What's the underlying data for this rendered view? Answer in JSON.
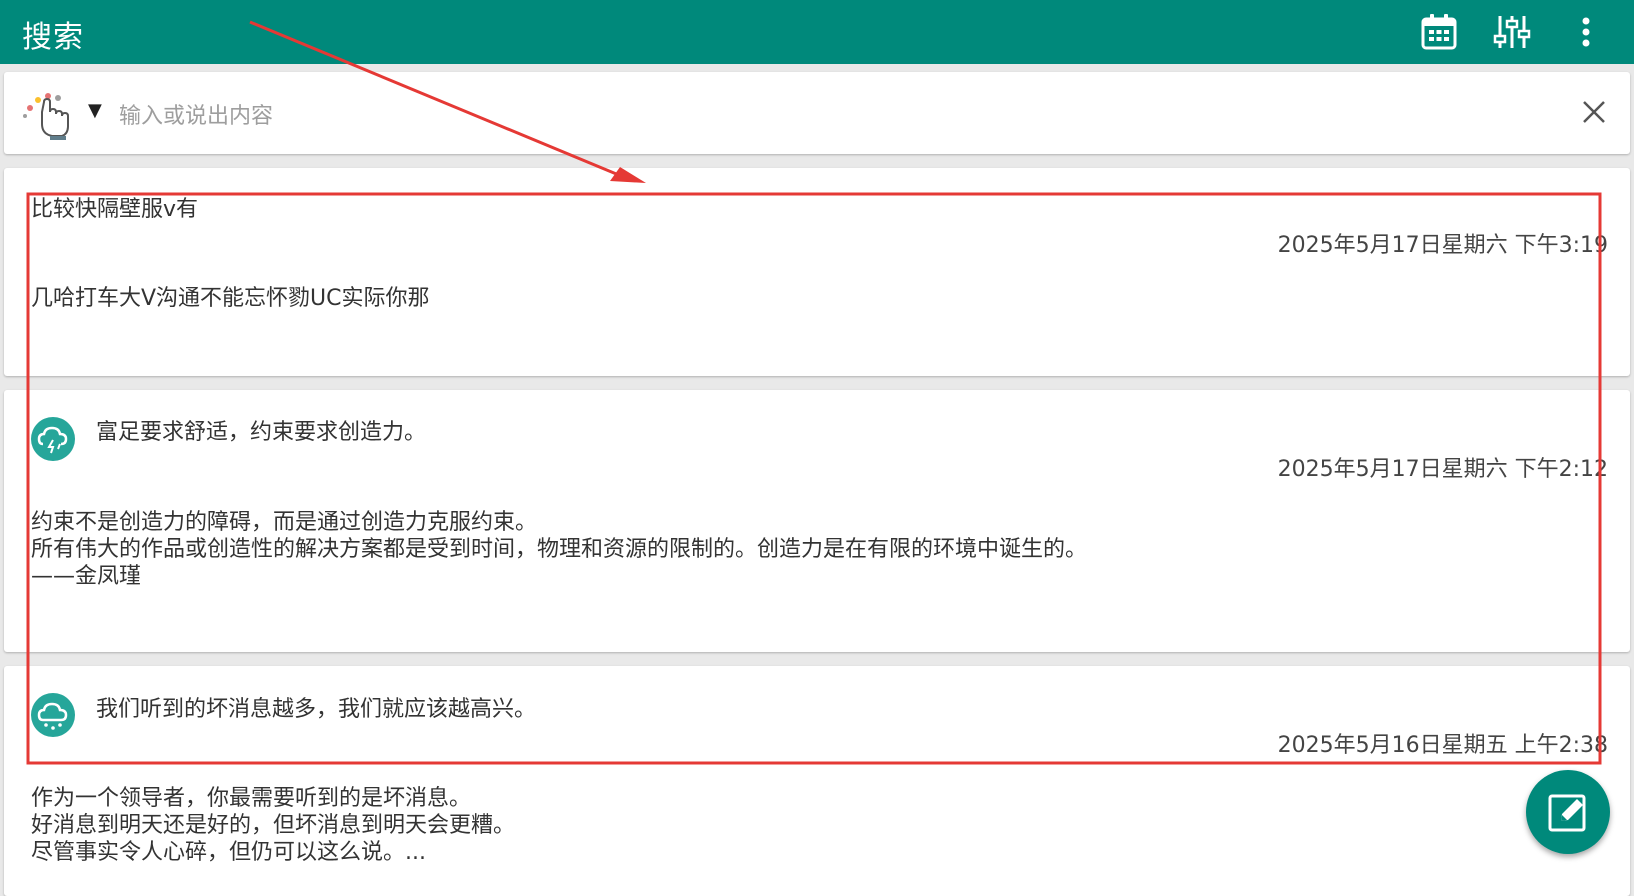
{
  "appbar": {
    "title": "搜索",
    "actions": [
      "calendar-icon",
      "tune-icon",
      "more-vert-icon"
    ],
    "color": "#00897b"
  },
  "search": {
    "placeholder": "输入或说出内容",
    "mode_icon": "hand-icon",
    "dropdown_symbol": "▼"
  },
  "cards": [
    {
      "title": "比较快隔壁服v有",
      "date": "2025年5月17日星期六 下午3:19",
      "body": [
        "几哈打车大V沟通不能忘怀勠UC实际你那"
      ]
    },
    {
      "icon": "cloud-lightning-icon",
      "title": "富足要求舒适，约束要求创造力。",
      "date": "2025年5月17日星期六 下午2:12",
      "body": [
        "约束不是创造力的障碍，而是通过创造力克服约束。",
        "所有伟大的作品或创造性的解决方案都是受到时间，物理和资源的限制的。创造力是在有限的环境中诞生的。",
        "——金凤瑾"
      ]
    },
    {
      "icon": "cloud-rain-icon",
      "title": "我们听到的坏消息越多，我们就应该越高兴。",
      "date": "2025年5月16日星期五 上午2:38",
      "body": [
        "作为一个领导者，你最需要听到的是坏消息。",
        "好消息到明天还是好的，但坏消息到明天会更糟。",
        "尽管事实令人心碎，但仍可以这么说。..."
      ]
    }
  ],
  "fab": {
    "icon": "edit-icon"
  },
  "annotation_color": "#e53935"
}
